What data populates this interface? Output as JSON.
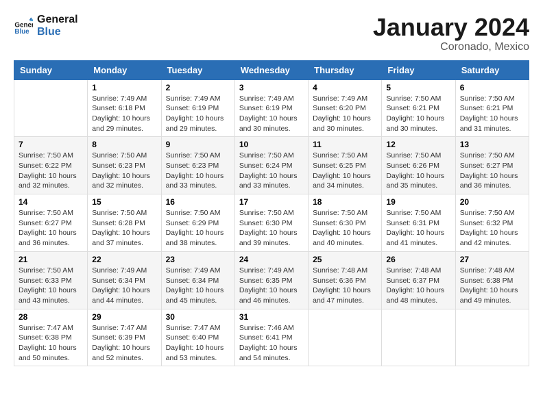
{
  "logo": {
    "line1": "General",
    "line2": "Blue"
  },
  "title": "January 2024",
  "subtitle": "Coronado, Mexico",
  "days_of_week": [
    "Sunday",
    "Monday",
    "Tuesday",
    "Wednesday",
    "Thursday",
    "Friday",
    "Saturday"
  ],
  "weeks": [
    [
      {
        "day": "",
        "info": ""
      },
      {
        "day": "1",
        "info": "Sunrise: 7:49 AM\nSunset: 6:18 PM\nDaylight: 10 hours\nand 29 minutes."
      },
      {
        "day": "2",
        "info": "Sunrise: 7:49 AM\nSunset: 6:19 PM\nDaylight: 10 hours\nand 29 minutes."
      },
      {
        "day": "3",
        "info": "Sunrise: 7:49 AM\nSunset: 6:19 PM\nDaylight: 10 hours\nand 30 minutes."
      },
      {
        "day": "4",
        "info": "Sunrise: 7:49 AM\nSunset: 6:20 PM\nDaylight: 10 hours\nand 30 minutes."
      },
      {
        "day": "5",
        "info": "Sunrise: 7:50 AM\nSunset: 6:21 PM\nDaylight: 10 hours\nand 30 minutes."
      },
      {
        "day": "6",
        "info": "Sunrise: 7:50 AM\nSunset: 6:21 PM\nDaylight: 10 hours\nand 31 minutes."
      }
    ],
    [
      {
        "day": "7",
        "info": "Sunrise: 7:50 AM\nSunset: 6:22 PM\nDaylight: 10 hours\nand 32 minutes."
      },
      {
        "day": "8",
        "info": "Sunrise: 7:50 AM\nSunset: 6:23 PM\nDaylight: 10 hours\nand 32 minutes."
      },
      {
        "day": "9",
        "info": "Sunrise: 7:50 AM\nSunset: 6:23 PM\nDaylight: 10 hours\nand 33 minutes."
      },
      {
        "day": "10",
        "info": "Sunrise: 7:50 AM\nSunset: 6:24 PM\nDaylight: 10 hours\nand 33 minutes."
      },
      {
        "day": "11",
        "info": "Sunrise: 7:50 AM\nSunset: 6:25 PM\nDaylight: 10 hours\nand 34 minutes."
      },
      {
        "day": "12",
        "info": "Sunrise: 7:50 AM\nSunset: 6:26 PM\nDaylight: 10 hours\nand 35 minutes."
      },
      {
        "day": "13",
        "info": "Sunrise: 7:50 AM\nSunset: 6:27 PM\nDaylight: 10 hours\nand 36 minutes."
      }
    ],
    [
      {
        "day": "14",
        "info": "Sunrise: 7:50 AM\nSunset: 6:27 PM\nDaylight: 10 hours\nand 36 minutes."
      },
      {
        "day": "15",
        "info": "Sunrise: 7:50 AM\nSunset: 6:28 PM\nDaylight: 10 hours\nand 37 minutes."
      },
      {
        "day": "16",
        "info": "Sunrise: 7:50 AM\nSunset: 6:29 PM\nDaylight: 10 hours\nand 38 minutes."
      },
      {
        "day": "17",
        "info": "Sunrise: 7:50 AM\nSunset: 6:30 PM\nDaylight: 10 hours\nand 39 minutes."
      },
      {
        "day": "18",
        "info": "Sunrise: 7:50 AM\nSunset: 6:30 PM\nDaylight: 10 hours\nand 40 minutes."
      },
      {
        "day": "19",
        "info": "Sunrise: 7:50 AM\nSunset: 6:31 PM\nDaylight: 10 hours\nand 41 minutes."
      },
      {
        "day": "20",
        "info": "Sunrise: 7:50 AM\nSunset: 6:32 PM\nDaylight: 10 hours\nand 42 minutes."
      }
    ],
    [
      {
        "day": "21",
        "info": "Sunrise: 7:50 AM\nSunset: 6:33 PM\nDaylight: 10 hours\nand 43 minutes."
      },
      {
        "day": "22",
        "info": "Sunrise: 7:49 AM\nSunset: 6:34 PM\nDaylight: 10 hours\nand 44 minutes."
      },
      {
        "day": "23",
        "info": "Sunrise: 7:49 AM\nSunset: 6:34 PM\nDaylight: 10 hours\nand 45 minutes."
      },
      {
        "day": "24",
        "info": "Sunrise: 7:49 AM\nSunset: 6:35 PM\nDaylight: 10 hours\nand 46 minutes."
      },
      {
        "day": "25",
        "info": "Sunrise: 7:48 AM\nSunset: 6:36 PM\nDaylight: 10 hours\nand 47 minutes."
      },
      {
        "day": "26",
        "info": "Sunrise: 7:48 AM\nSunset: 6:37 PM\nDaylight: 10 hours\nand 48 minutes."
      },
      {
        "day": "27",
        "info": "Sunrise: 7:48 AM\nSunset: 6:38 PM\nDaylight: 10 hours\nand 49 minutes."
      }
    ],
    [
      {
        "day": "28",
        "info": "Sunrise: 7:47 AM\nSunset: 6:38 PM\nDaylight: 10 hours\nand 50 minutes."
      },
      {
        "day": "29",
        "info": "Sunrise: 7:47 AM\nSunset: 6:39 PM\nDaylight: 10 hours\nand 52 minutes."
      },
      {
        "day": "30",
        "info": "Sunrise: 7:47 AM\nSunset: 6:40 PM\nDaylight: 10 hours\nand 53 minutes."
      },
      {
        "day": "31",
        "info": "Sunrise: 7:46 AM\nSunset: 6:41 PM\nDaylight: 10 hours\nand 54 minutes."
      },
      {
        "day": "",
        "info": ""
      },
      {
        "day": "",
        "info": ""
      },
      {
        "day": "",
        "info": ""
      }
    ]
  ]
}
